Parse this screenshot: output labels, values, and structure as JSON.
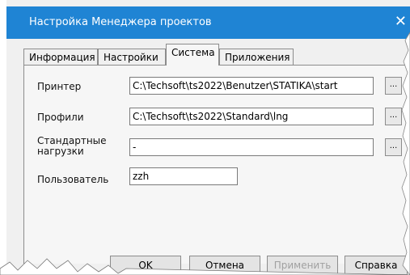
{
  "window": {
    "title": "Настройка Менеджера проектов",
    "close_label": "✕"
  },
  "tabs": [
    {
      "label": "Информация",
      "active": false
    },
    {
      "label": "Настройки",
      "active": false
    },
    {
      "label": "Система",
      "active": true
    },
    {
      "label": "Приложения",
      "active": false
    }
  ],
  "fields": [
    {
      "label": "Принтер",
      "value": "C:\\Techsoft\\ts2022\\Benutzer\\STATIKA\\start"
    },
    {
      "label": "Профили",
      "value": "C:\\Techsoft\\ts2022\\Standard\\lng"
    },
    {
      "label": "Стандартные нагрузки",
      "value": "-"
    },
    {
      "label": "Пользователь",
      "value": "zzh"
    }
  ],
  "browse_label": "...",
  "buttons": {
    "ok": "OK",
    "cancel": "Отмена",
    "apply": "Применить",
    "help": "Справка"
  }
}
